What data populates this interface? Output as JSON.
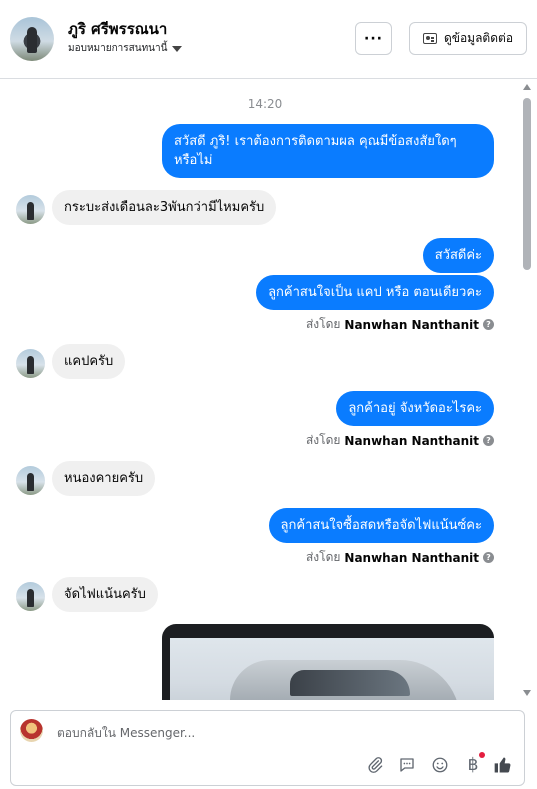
{
  "header": {
    "name": "ภูริ ศรีพรรณนา",
    "assign_label": "มอบหมายการสนทนานี้",
    "more_label": "···",
    "contact_info_label": "ดูข้อมูลติดต่อ"
  },
  "chat": {
    "timestamp": "14:20",
    "messages": [
      {
        "dir": "out",
        "text": "สวัสดี ภูริ! เราต้องการติดตามผล คุณมีข้อสงสัยใดๆ หรือไม่"
      },
      {
        "dir": "in",
        "text": "กระบะส่งเดือนละ3พันกว่ามีไหมครับ"
      },
      {
        "dir": "out",
        "text": "สวัสดีค่ะ"
      },
      {
        "dir": "out",
        "text": "ลูกค้าสนใจเป็น แคป หรือ ตอนเดียวคะ"
      },
      {
        "dir": "in",
        "text": "แคปครับ"
      },
      {
        "dir": "out",
        "text": "ลูกค้าอยู่ จังหวัดอะไรคะ"
      },
      {
        "dir": "in",
        "text": "หนองคายครับ"
      },
      {
        "dir": "out",
        "text": "ลูกค้าสนใจซื้อสดหรือจัดไฟแน้นซ์คะ"
      },
      {
        "dir": "in",
        "text": "จัดไฟแน้นครับ"
      }
    ],
    "sent_by_prefix": "ส่งโดย",
    "sent_by_name": "Nanwhan Nanthanit"
  },
  "composer": {
    "placeholder": "ตอบกลับใน Messenger..."
  },
  "icons": {
    "attach": "paperclip-icon",
    "saved_reply": "chat-bubble-icon",
    "emoji": "emoji-icon",
    "payment": "baht-icon",
    "like": "thumbs-up-icon"
  },
  "colors": {
    "outgoing_bubble": "#0a7cff",
    "incoming_bubble": "#f0f0f0",
    "notification_dot": "#e41e3f"
  }
}
